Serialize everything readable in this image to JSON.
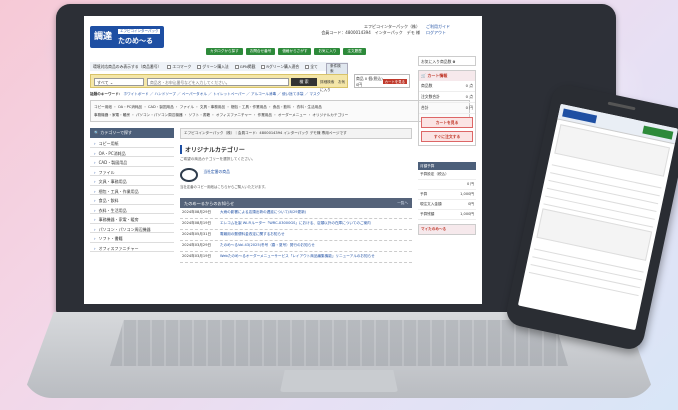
{
  "header": {
    "logo_big": "調達",
    "logo_sub": "エフピコインターパック",
    "logo_name": "たのめ～る",
    "user_line1": "エフピコインターパック（株）",
    "user_line2": "会員コード：4800014394　インターパック　デモ 様",
    "links": [
      "ご利用ガイド",
      "ログアウト"
    ],
    "nav_buttons": [
      "カタログから探す",
      "お問合せ番号",
      "価格からさがす",
      "お気に入り",
      "注文履歴"
    ]
  },
  "search_bar": {
    "conditions_label": "環境対応商品のみ表示する（商品番号）",
    "filters": [
      "エコマーク",
      "グリーン購入法",
      "GPN掲載",
      "Rグリーン購入適合",
      "全て"
    ],
    "conditions_button": "条件検索",
    "category_select": "すべて",
    "placeholder": "商品名・お申込番号などを入力してください。",
    "search_button": "検 索",
    "advanced_links": "詳細検索　お気に入り",
    "cart_mini": "商品 0 個(税込)",
    "cart_mini_total": "0円",
    "cart_button": "カートを見る"
  },
  "keywords": {
    "label": "話題のキーワード：",
    "items": [
      "ホワイトボード",
      "ハンドソープ",
      "ペーパータオル",
      "トイレットペーパー",
      "アルコール消毒",
      "使い捨て手袋",
      "マスク"
    ]
  },
  "categories_bar": [
    "コピー用紙",
    "OA・PC消耗品",
    "CAD・製図用品",
    "ファイル",
    "文具・事務用品",
    "梱包・工具・作業用品",
    "食品・飲料",
    "衣料・生活用品",
    "事務機器・家電・暖房",
    "パソコン・パソコン周辺機器",
    "ソフト・書籍",
    "オフィスファニチャー",
    "作業用品",
    "オーダーメニュー",
    "オリジナルカテゴリー"
  ],
  "sidebar": {
    "title": "カテゴリーで探す",
    "items": [
      "コピー用紙",
      "OA・PC消耗品",
      "CAD・製図用品",
      "ファイル",
      "文具・事務用品",
      "梱包・工具・作業用品",
      "食品・飲料",
      "衣料・生活用品",
      "事務機器・家電・暖房",
      "パソコン・パソコン周辺機器",
      "ソフト・書籍",
      "オフィスファニチャー"
    ]
  },
  "main": {
    "breadcrumb": "エフピコインターパック（株）｜会員コード：4800014394 インターパック デモ様 専用ページです",
    "title": "オリジナルカテゴリー",
    "description": "ご希望の商品カテゴリーを選択してください。",
    "category_link": "当社定番の商品",
    "category_desc": "当社定番のコピー用紙はこちらからご購入いただけます。"
  },
  "news": {
    "title": "たのめ～るからのお知らせ",
    "more": "一覧へ",
    "rows": [
      {
        "date": "2024年08月29日",
        "text": "大雨の影響による店頭出荷の遅延について(8/29更新)"
      },
      {
        "date": "2024年08月19日",
        "text": "エレコム社製 Wi-Fiルーター「WRC-X3000GS」における、店頭以外の在庫についてのご案内"
      },
      {
        "date": "2024年05月31日",
        "text": "電報用の郵便料金改定に関するお知らせ"
      },
      {
        "date": "2024年03月29日",
        "text": "たのめ～るVol.43(2025)冬号（春・夏号）発行のお知らせ"
      },
      {
        "date": "2024年03月19日",
        "text": "Webたのめ～るオーダーメニューサービス「レイアウト商品編集機能」リニューアルのお知らせ"
      }
    ]
  },
  "right_column": {
    "favorites_label": "お気に入り商品数",
    "favorites_count": "0",
    "cart_title": "カート情報",
    "cart_rows": [
      {
        "label": "商品数",
        "value": "0 点"
      },
      {
        "label": "注文数合計",
        "value": "0 点"
      },
      {
        "label": "合計",
        "value": "0 円"
      }
    ],
    "cart_view_button": "カートを見る",
    "checkout_button": "すぐに注文する",
    "recent_link": "すぐに注文履歴"
  },
  "order_panel": {
    "title": "月額予算",
    "rows": [
      {
        "label": "予算設定（税込）",
        "value": ""
      },
      {
        "label": "",
        "value": "0 円"
      },
      {
        "label": "予算",
        "value": "1,000円"
      },
      {
        "label": "現注文入金額",
        "value": "0円"
      },
      {
        "label": "予算残額",
        "value": "1,000円"
      }
    ],
    "mymenu_title": "マイたのめ～る"
  }
}
